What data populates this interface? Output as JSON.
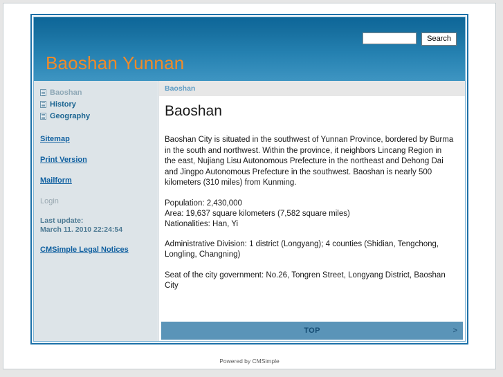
{
  "header": {
    "site_title": "Baoshan Yunnan",
    "title_color": "#f08b2a",
    "gradient_top": "#0d6699",
    "gradient_bottom": "#3e95c2",
    "search": {
      "value": "",
      "placeholder": "",
      "button_label": "Search",
      "icon": "search-icon"
    }
  },
  "sidebar": {
    "menu": [
      {
        "label": "Baoshan",
        "icon": "page-icon",
        "active": true
      },
      {
        "label": "History",
        "icon": "page-icon",
        "active": false
      },
      {
        "label": "Geography",
        "icon": "page-icon",
        "active": false
      }
    ],
    "links": [
      {
        "label": "Sitemap"
      },
      {
        "label": "Print Version"
      },
      {
        "label": "Mailform"
      }
    ],
    "login_label": "Login",
    "last_update_label": "Last update:",
    "last_update_value": "March 11. 2010 22:24:54",
    "legal_link": "CMSimple Legal Notices",
    "background": "#dde4e8"
  },
  "content": {
    "breadcrumb": "Baoshan",
    "heading": "Baoshan",
    "paragraphs": [
      "Baoshan City is situated in the southwest of Yunnan Province, bordered by Burma in the south and northwest. Within the province, it neighbors Lincang Region in the east, Nujiang Lisu Autonomous Prefecture in the northeast and Dehong Dai and Jingpo Autonomous Prefecture in the southwest. Baoshan is nearly 500 kilometers (310 miles) from Kunming.",
      "Population: 2,430,000",
      "Area: 19,637 square kilometers (7,582 square miles)",
      "Nationalities: Han, Yi",
      "Administrative Division: 1 district (Longyang); 4 counties (Shidian, Tengchong, Longling, Changning)",
      "Seat of the city government: No.26, Tongren Street, Longyang District, Baoshan City"
    ]
  },
  "top_bar": {
    "label": "TOP",
    "arrow": ">",
    "background": "#5a94b8"
  },
  "footer": {
    "powered_by": "Powered by CMSimple"
  }
}
